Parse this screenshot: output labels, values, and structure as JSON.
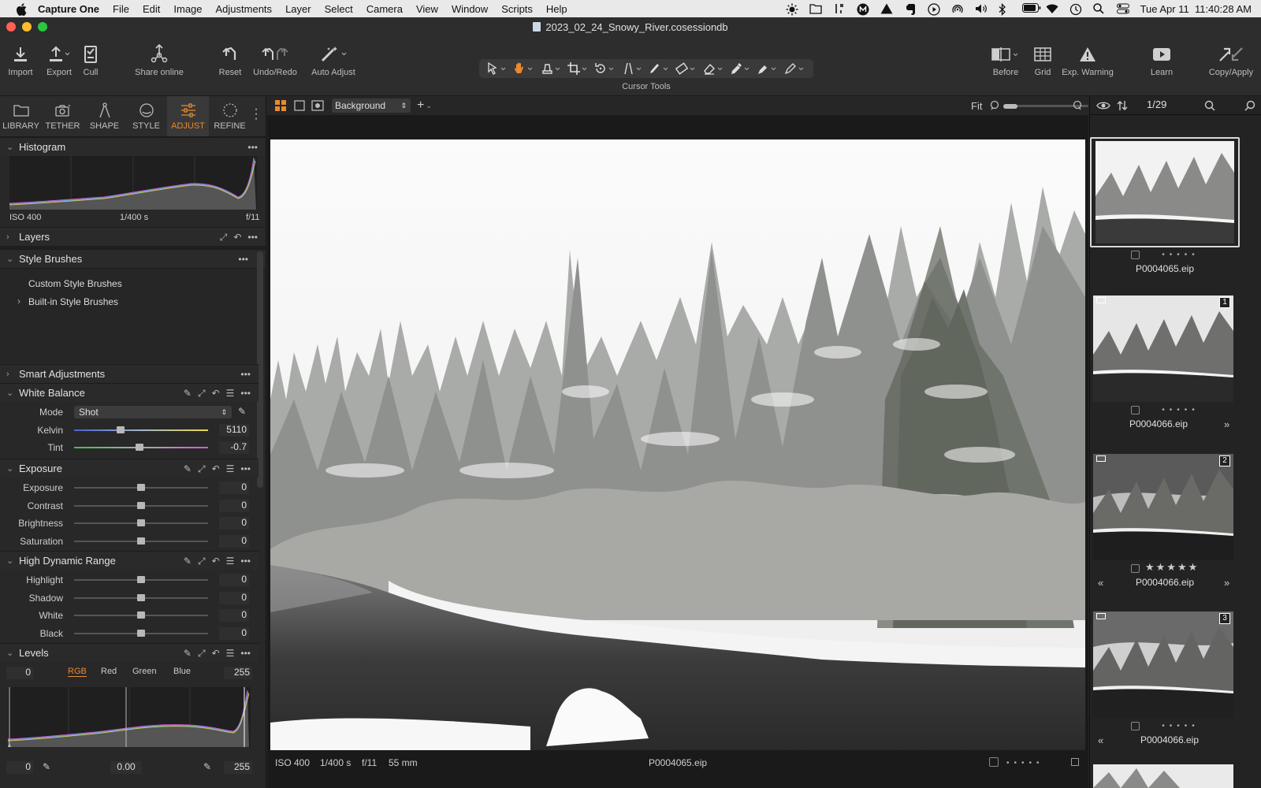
{
  "menubar": {
    "app": "Capture One",
    "items": [
      "File",
      "Edit",
      "Image",
      "Adjustments",
      "Layer",
      "Select",
      "Camera",
      "View",
      "Window",
      "Scripts",
      "Help"
    ],
    "clock": "Tue Apr 11  11:40:28 AM"
  },
  "window": {
    "title": "2023_02_24_Snowy_River.cosessiondb"
  },
  "toolbar": {
    "import": "Import",
    "export": "Export",
    "cull": "Cull",
    "share": "Share online",
    "reset": "Reset",
    "undo_redo": "Undo/Redo",
    "auto_adjust": "Auto Adjust",
    "cursor_tools": "Cursor Tools",
    "before": "Before",
    "grid": "Grid",
    "exp_warning": "Exp. Warning",
    "learn": "Learn",
    "copy_apply": "Copy/Apply"
  },
  "tooltabs": [
    "LIBRARY",
    "TETHER",
    "SHAPE",
    "STYLE",
    "ADJUST",
    "REFINE"
  ],
  "histogram": {
    "title": "Histogram",
    "iso": "ISO 400",
    "shutter": "1/400 s",
    "aperture": "f/11"
  },
  "layers": {
    "title": "Layers"
  },
  "style_brushes": {
    "title": "Style Brushes",
    "custom": "Custom Style Brushes",
    "builtin": "Built-in Style Brushes"
  },
  "smart_adjustments": {
    "title": "Smart Adjustments"
  },
  "white_balance": {
    "title": "White Balance",
    "mode_label": "Mode",
    "mode_value": "Shot",
    "kelvin_label": "Kelvin",
    "kelvin": "5110",
    "kelvin_pos": 0.34,
    "tint_label": "Tint",
    "tint": "-0.7",
    "tint_pos": 0.49
  },
  "exposure": {
    "title": "Exposure",
    "rows": [
      {
        "label": "Exposure",
        "value": "0"
      },
      {
        "label": "Contrast",
        "value": "0"
      },
      {
        "label": "Brightness",
        "value": "0"
      },
      {
        "label": "Saturation",
        "value": "0"
      }
    ]
  },
  "hdr": {
    "title": "High Dynamic Range",
    "rows": [
      {
        "label": "Highlight",
        "value": "0"
      },
      {
        "label": "Shadow",
        "value": "0"
      },
      {
        "label": "White",
        "value": "0"
      },
      {
        "label": "Black",
        "value": "0"
      }
    ]
  },
  "levels": {
    "title": "Levels",
    "low": "0",
    "high": "255",
    "channels": [
      "RGB",
      "Red",
      "Green",
      "Blue"
    ],
    "out_low": "0",
    "mid": "0.00",
    "out_high": "255"
  },
  "viewer": {
    "layer": "Background",
    "fit": "Fit",
    "iso": "ISO 400",
    "shutter": "1/400 s",
    "aperture": "f/11",
    "focal": "55 mm",
    "filename": "P0004065.eip"
  },
  "browser": {
    "count": "1/29",
    "items": [
      {
        "name": "P0004065.eip",
        "badge": ""
      },
      {
        "name": "P0004066.eip",
        "badge": "1"
      },
      {
        "name": "P0004066.eip",
        "badge": "2",
        "stars": "★★★★★"
      },
      {
        "name": "P0004066.eip",
        "badge": "3"
      }
    ]
  },
  "colors": {
    "accent": "#e98a2f"
  }
}
